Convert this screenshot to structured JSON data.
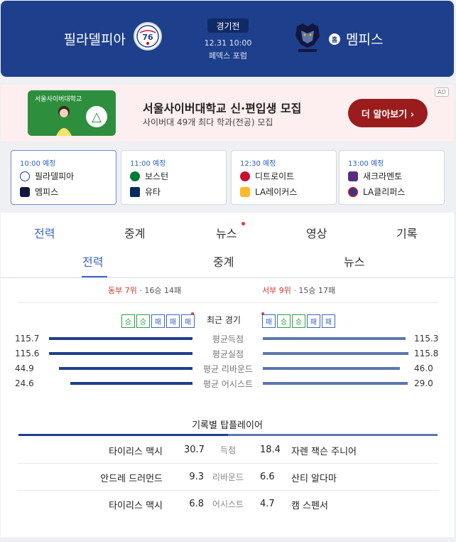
{
  "header": {
    "home_team": "필라델피아",
    "away_team": "멤피스",
    "status": "경기전",
    "datetime": "12.31 10:00",
    "venue": "페덱스 포럼",
    "home_badge": "홈"
  },
  "ad": {
    "image_text": "서울사이버대학교",
    "logo_glyph": "△",
    "title": "서울사이버대학교 신·편입생 모집",
    "subtitle": "사이버대 49개 최다 학과(전공) 모집",
    "cta": "더 알아보기 ›",
    "tag": "AD"
  },
  "schedule": [
    {
      "time": "10:00 예정",
      "team1": "필라델피아",
      "team2": "멤피스"
    },
    {
      "time": "11:00 예정",
      "team1": "보스턴",
      "team2": "유타"
    },
    {
      "time": "12:30 예정",
      "team1": "디트로이트",
      "team2": "LA레이커스"
    },
    {
      "time": "13:00 예정",
      "team1": "새크라멘토",
      "team2": "LA클리퍼스"
    }
  ],
  "tabs_primary": [
    "전력",
    "중계",
    "뉴스",
    "영상",
    "기록"
  ],
  "tabs_secondary": [
    "전력",
    "중계",
    "뉴스"
  ],
  "ranking": {
    "left_conf": "동부 7위",
    "left_record": " · 16승 14패",
    "right_conf": "서부 9위",
    "right_record": " · 15승 17패"
  },
  "recent": {
    "label": "최근 경기",
    "left": [
      "승",
      "승",
      "패",
      "패",
      "패"
    ],
    "right": [
      "패",
      "승",
      "승",
      "패",
      "패"
    ]
  },
  "stats": [
    {
      "label": "평균득점",
      "left": "115.7",
      "right": "115.3"
    },
    {
      "label": "평균실점",
      "left": "115.6",
      "right": "115.8"
    },
    {
      "label": "평균 리바운드",
      "left": "44.9",
      "right": "46.0"
    },
    {
      "label": "평균 어시스트",
      "left": "24.6",
      "right": "29.0"
    }
  ],
  "top_players": {
    "title": "기록별 탑플레이어",
    "rows": [
      {
        "cat": "득점",
        "left_player": "타이리스 맥시",
        "left_val": "30.7",
        "right_val": "18.4",
        "right_player": "자렌 잭슨 주니어"
      },
      {
        "cat": "리바운드",
        "left_player": "안드레 드러먼드",
        "left_val": "9.3",
        "right_val": "6.6",
        "right_player": "산티 알다마"
      },
      {
        "cat": "어시스트",
        "left_player": "타이리스 맥시",
        "left_val": "6.8",
        "right_val": "4.7",
        "right_player": "캠 스펜서"
      }
    ]
  },
  "colors": {
    "home": "#1e3f8b",
    "away": "#5c77ad",
    "accent": "#3b66c6",
    "win": "#2e9e4a"
  }
}
